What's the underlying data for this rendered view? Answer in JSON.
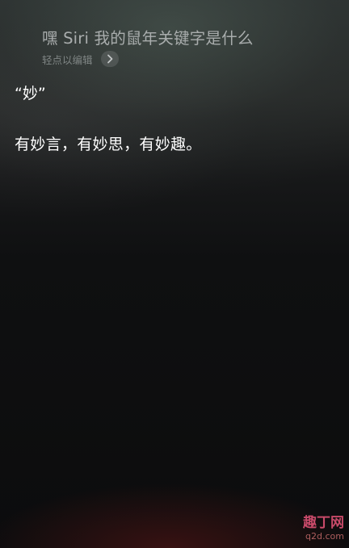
{
  "siri": {
    "request": "嘿 Siri 我的鼠年关键字是什么",
    "edit_hint": "轻点以编辑",
    "answer_quote": "“妙”",
    "answer_text": "有妙言，有妙思，有妙趣。"
  },
  "icons": {
    "edit": "chevron-right-icon"
  },
  "watermark": {
    "title": "趣丁网",
    "url": "q2d.com"
  },
  "colors": {
    "request_text": "#a9adad",
    "answer_text": "#ffffff",
    "watermark": "#e8557a"
  }
}
